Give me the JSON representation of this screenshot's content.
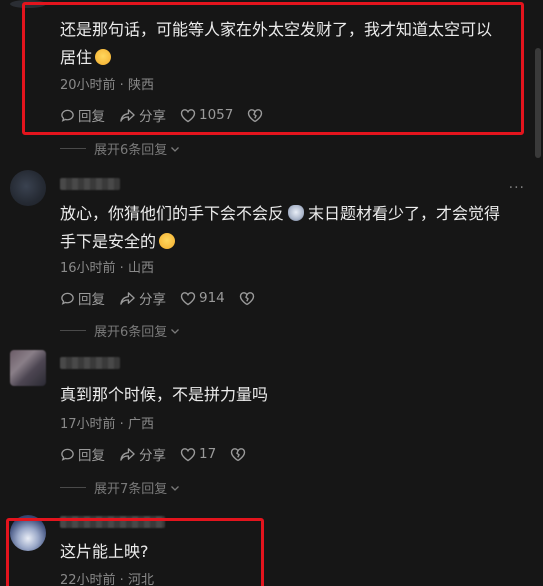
{
  "comments": [
    {
      "line1": "还是那句话，可能等人家在外太空发财了，我才知道太空可以",
      "line2": "居住",
      "emoji": "sweat-smile-emoji",
      "meta": "20小时前 · 陕西",
      "reply": "回复",
      "share": "分享",
      "likes": "1057",
      "expand": "展开6条回复"
    },
    {
      "line1": "放心，你猜他们的手下会不会反",
      "emoji1": "cat-emoji",
      "line1b": "末日题材看少了，才会觉得",
      "line2": "手下是安全的",
      "emoji2": "laugh-cry-emoji",
      "meta": "16小时前 · 山西",
      "reply": "回复",
      "share": "分享",
      "likes": "914",
      "expand": "展开6条回复"
    },
    {
      "line1": "真到那个时候，不是拼力量吗",
      "meta": "17小时前 · 广西",
      "reply": "回复",
      "share": "分享",
      "likes": "17",
      "expand": "展开7条回复"
    },
    {
      "line1": "这片能上映?",
      "meta": "22小时前 · 河北"
    }
  ],
  "more_menu": "···",
  "colors": {
    "background": "#161616",
    "highlight": "#e3141d",
    "text": "#ececec",
    "meta": "#8a8a8a"
  }
}
